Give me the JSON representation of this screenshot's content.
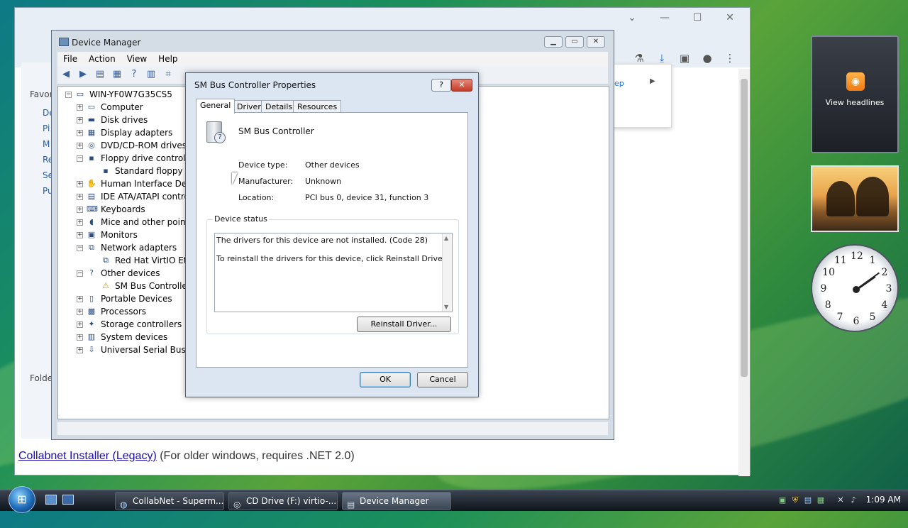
{
  "browser": {
    "link_text": "Collabnet Installer (Legacy)",
    "link_suffix": " (For older windows, requires .NET 2.0)",
    "popup_text": "ep"
  },
  "gadgets": {
    "feed_label": "View headlines",
    "clock_numbers": [
      "12",
      "1",
      "2",
      "3",
      "4",
      "5",
      "6",
      "7",
      "8",
      "9",
      "10",
      "11"
    ]
  },
  "left_panel": {
    "items": [
      "Favor",
      "De",
      "Pi",
      "M",
      "Re",
      "Se",
      "Pu",
      "Folde"
    ]
  },
  "device_manager": {
    "title": "Device Manager",
    "menu": [
      "File",
      "Action",
      "View",
      "Help"
    ],
    "tree": [
      {
        "label": "WIN-YF0W7G35CS5",
        "level": 0,
        "expander": "−",
        "icon": "computer-icon"
      },
      {
        "label": "Computer",
        "level": 1,
        "expander": "+",
        "icon": "computer-icon"
      },
      {
        "label": "Disk drives",
        "level": 1,
        "expander": "+",
        "icon": "disk-icon"
      },
      {
        "label": "Display adapters",
        "level": 1,
        "expander": "+",
        "icon": "display-icon"
      },
      {
        "label": "DVD/CD-ROM drives",
        "level": 1,
        "expander": "+",
        "icon": "cd-icon"
      },
      {
        "label": "Floppy drive controllers",
        "level": 1,
        "expander": "−",
        "icon": "floppy-icon"
      },
      {
        "label": "Standard floppy disk controller",
        "level": 2,
        "expander": "",
        "icon": "floppy-icon"
      },
      {
        "label": "Human Interface Devices",
        "level": 1,
        "expander": "+",
        "icon": "hid-icon"
      },
      {
        "label": "IDE ATA/ATAPI controllers",
        "level": 1,
        "expander": "+",
        "icon": "ide-icon"
      },
      {
        "label": "Keyboards",
        "level": 1,
        "expander": "+",
        "icon": "keyboard-icon"
      },
      {
        "label": "Mice and other pointing devices",
        "level": 1,
        "expander": "+",
        "icon": "mouse-icon"
      },
      {
        "label": "Monitors",
        "level": 1,
        "expander": "+",
        "icon": "monitor-icon"
      },
      {
        "label": "Network adapters",
        "level": 1,
        "expander": "−",
        "icon": "network-icon"
      },
      {
        "label": "Red Hat VirtIO Ethernet Adapter",
        "level": 2,
        "expander": "",
        "icon": "network-icon"
      },
      {
        "label": "Other devices",
        "level": 1,
        "expander": "−",
        "icon": "unknown-device-icon"
      },
      {
        "label": "SM Bus Controller",
        "level": 2,
        "expander": "",
        "icon": "warning-device-icon"
      },
      {
        "label": "Portable Devices",
        "level": 1,
        "expander": "+",
        "icon": "portable-icon"
      },
      {
        "label": "Processors",
        "level": 1,
        "expander": "+",
        "icon": "processor-icon"
      },
      {
        "label": "Storage controllers",
        "level": 1,
        "expander": "+",
        "icon": "storage-icon"
      },
      {
        "label": "System devices",
        "level": 1,
        "expander": "+",
        "icon": "system-icon"
      },
      {
        "label": "Universal Serial Bus controllers",
        "level": 1,
        "expander": "+",
        "icon": "usb-icon"
      }
    ]
  },
  "properties": {
    "title": "SM Bus Controller Properties",
    "tabs": [
      "General",
      "Driver",
      "Details",
      "Resources"
    ],
    "device_name": "SM Bus Controller",
    "fields": [
      {
        "label": "Device type:",
        "value": "Other devices"
      },
      {
        "label": "Manufacturer:",
        "value": "Unknown"
      },
      {
        "label": "Location:",
        "value": "PCI bus 0, device 31, function 3"
      }
    ],
    "status_group_label": "Device status",
    "status_line1": "The drivers for this device are not installed. (Code 28)",
    "status_line2": "To reinstall the drivers for this device, click Reinstall Driver.",
    "reinstall_label": "Reinstall Driver...",
    "ok_label": "OK",
    "cancel_label": "Cancel"
  },
  "taskbar": {
    "tasks": [
      {
        "label": "CollabNet - Superm..."
      },
      {
        "label": "CD Drive (F:) virtio-..."
      },
      {
        "label": "Device Manager"
      }
    ],
    "clock": "1:09 AM"
  }
}
